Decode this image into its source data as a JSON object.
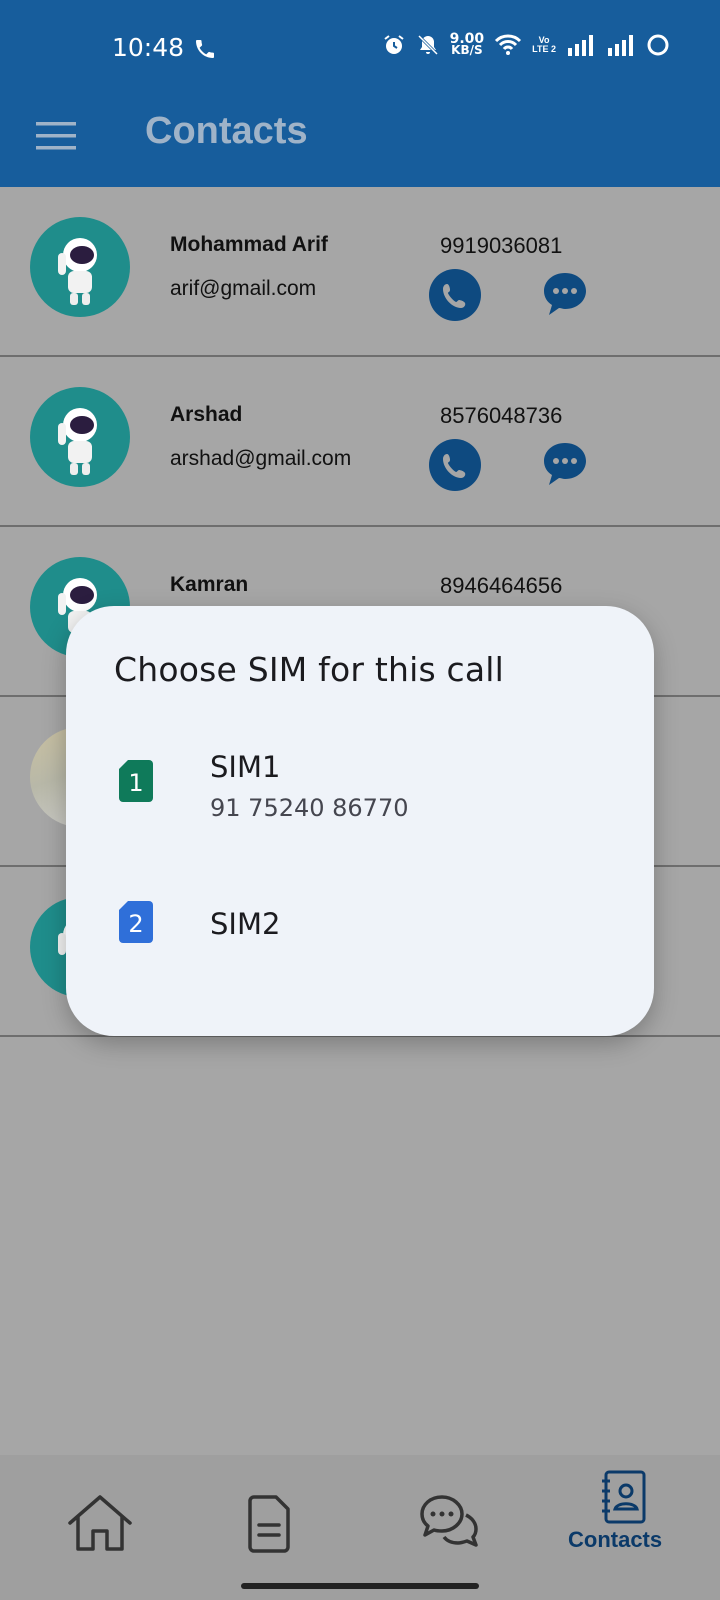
{
  "status_bar": {
    "time": "10:48",
    "net_speed_value": "9.00",
    "net_speed_unit": "KB/S",
    "volte_line1": "Vo",
    "volte_line2": "LTE 2"
  },
  "app_bar": {
    "title": "Contacts"
  },
  "contacts": [
    {
      "name": "Mohammad Arif",
      "email": "arif@gmail.com",
      "phone": "9919036081",
      "avatar": "astronaut-avatar"
    },
    {
      "name": "Arshad",
      "email": "arshad@gmail.com",
      "phone": "8576048736",
      "avatar": "astronaut-avatar"
    },
    {
      "name": "Kamran",
      "email": "",
      "phone": "8946464656",
      "avatar": "astronaut-avatar"
    },
    {
      "name": "",
      "email": "",
      "phone": "",
      "avatar": "photo-avatar"
    },
    {
      "name": "",
      "email": "",
      "phone": "",
      "avatar": "astronaut-avatar"
    }
  ],
  "dialog": {
    "title": "Choose SIM for this call",
    "options": [
      {
        "badge": "1",
        "label": "SIM1",
        "number": "91 75240 86770",
        "color": "#0f7a5a"
      },
      {
        "badge": "2",
        "label": "SIM2",
        "number": "",
        "color": "#2f6fd9"
      }
    ]
  },
  "bottom_nav": {
    "items": [
      {
        "icon": "home-icon",
        "label": ""
      },
      {
        "icon": "document-icon",
        "label": ""
      },
      {
        "icon": "chat-icon",
        "label": ""
      },
      {
        "icon": "contacts-book-icon",
        "label": "Contacts"
      }
    ]
  },
  "colors": {
    "app_bar": "#175d9c",
    "scrim_background": "#a6a6a6",
    "dialog_surface": "#eff3f9",
    "accent": "#0b3a69"
  }
}
